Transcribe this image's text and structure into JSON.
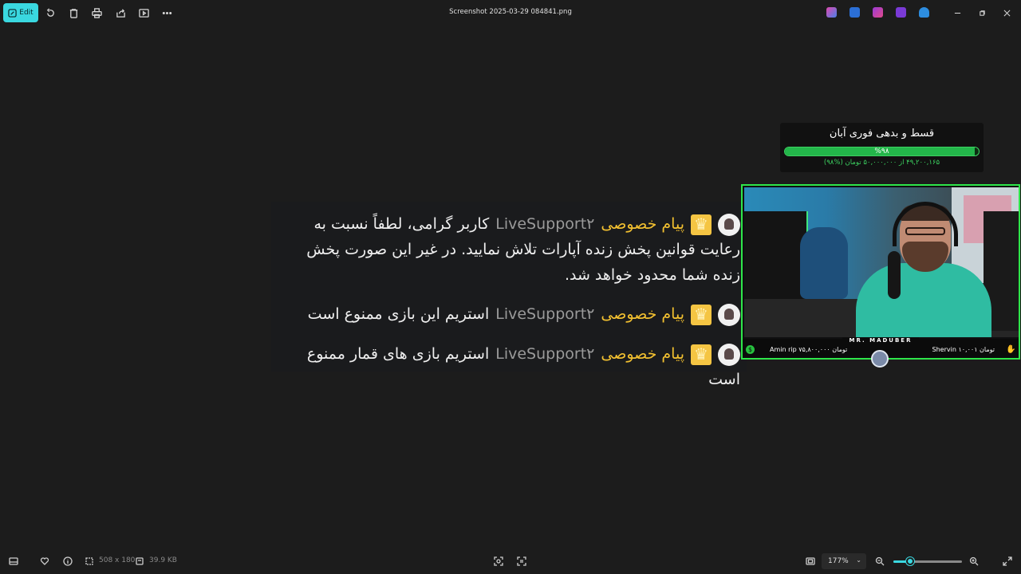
{
  "toolbar": {
    "edit_label": "Edit",
    "items": [
      "rotate-icon",
      "delete-icon",
      "print-icon",
      "share-icon",
      "slideshow-icon",
      "more-icon"
    ]
  },
  "window": {
    "title": "Screenshot 2025-03-29 084841.png"
  },
  "image": {
    "chat": {
      "messages": [
        {
          "avatar_icon": "support-avatar-icon",
          "badge_icon": "crown-icon",
          "label": "پیام خصوصی",
          "user": "LiveSupport۲",
          "text": "کاربر گرامی، لطفاً نسبت به رعایت قوانین پخش زنده آپارات تلاش نمایید. در غیر این صورت پخش زنده شما محدود خواهد شد."
        },
        {
          "avatar_icon": "support-avatar-icon",
          "badge_icon": "crown-icon",
          "label": "پیام خصوصی",
          "user": "LiveSupport۲",
          "text": "استریم این بازی ممنوع است"
        },
        {
          "avatar_icon": "support-avatar-icon",
          "badge_icon": "crown-icon",
          "label": "پیام خصوصی",
          "user": "LiveSupport۲",
          "text": "استریم بازی های قمار ممنوع است"
        }
      ]
    },
    "donation": {
      "title": "قسط و بدهی فوری آبان",
      "percent_label": "%۹۸",
      "progress": 0.98,
      "subtitle": "۴۹,۲۰۰,۱۶۵ از ۵۰,۰۰۰,۰۰۰ تومان (%۹۸)",
      "color": "#3cd160"
    },
    "webcam": {
      "brand": "MR. MADUBER",
      "left_donor": "Amin rip ۷۵,۸۰۰,۰۰۰ تومان",
      "right_donor": "Shervin ۱۰,۰۰۱ تومان",
      "border_color": "#2ee64a"
    }
  },
  "statusbar": {
    "dimensions": "508 x 180",
    "file_size": "39.9 KB",
    "zoom": "177%",
    "zoom_level": 0.25
  },
  "colors": {
    "accent": "#3ad8e0",
    "background": "#1c1c1c"
  }
}
